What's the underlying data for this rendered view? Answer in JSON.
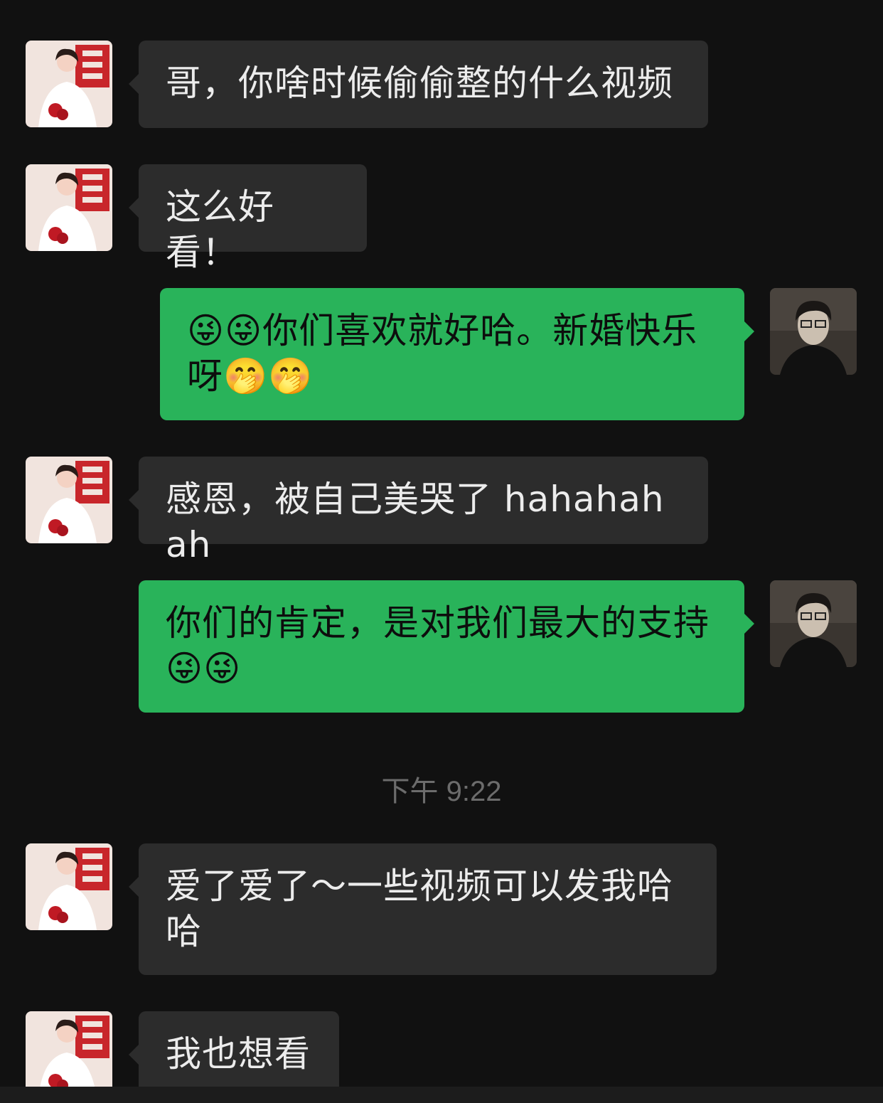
{
  "messages": [
    {
      "side": "in",
      "text": "哥，你啥时候偷偷整的什么视频"
    },
    {
      "side": "in",
      "text": "这么好看！"
    },
    {
      "side": "out",
      "text": "😜😜你们喜欢就好哈。新婚快乐呀🤭🤭"
    },
    {
      "side": "in",
      "text": "感恩，被自己美哭了 hahahahah"
    },
    {
      "side": "out",
      "text": "你们的肯定，是对我们最大的支持😜😜"
    },
    {
      "side": "in",
      "text": " 爱了爱了～一些视频可以发我哈哈"
    },
    {
      "side": "in",
      "text": "我也想看"
    }
  ],
  "timestamp": "下午 9:22",
  "avatars": {
    "contact": "bride-avatar",
    "self": "portrait-avatar"
  },
  "colors": {
    "background": "#111111",
    "incoming_bubble": "#2c2c2c",
    "outgoing_bubble": "#29b35a"
  }
}
